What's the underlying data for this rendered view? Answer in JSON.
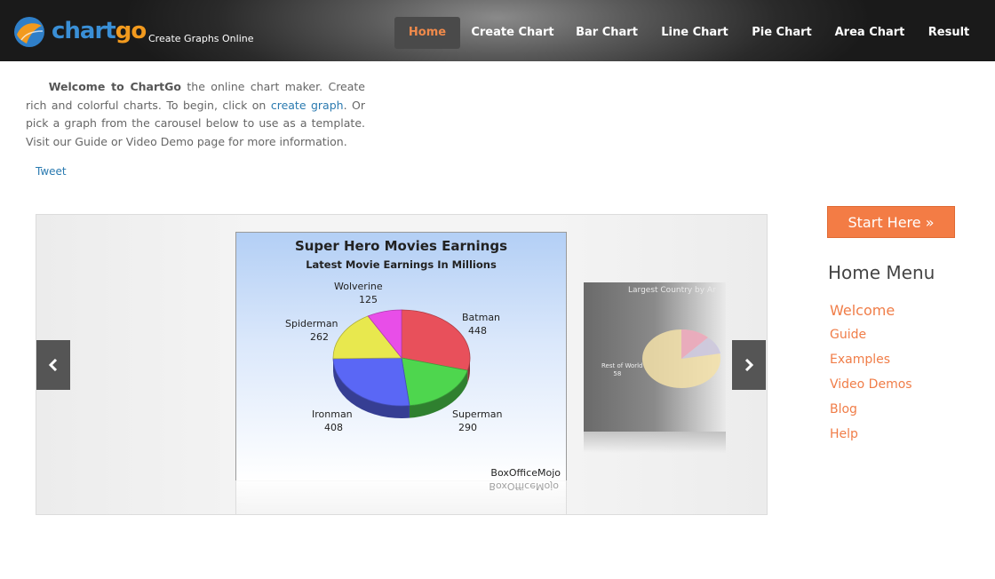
{
  "header": {
    "logo": {
      "part1": "chart",
      "part2": "go"
    },
    "tagline": "Create Graphs Online",
    "nav": [
      "Home",
      "Create Chart",
      "Bar Chart",
      "Line Chart",
      "Pie Chart",
      "Area Chart",
      "Result"
    ],
    "active_nav": "Home"
  },
  "intro": {
    "bold": "Welcome to ChartGo",
    "text1": " the online chart maker. Create rich and colorful charts. To begin, click on ",
    "link": "create graph",
    "text2": ". Or pick a graph from the carousel below to use as a template. Visit our Guide or Video Demo page for more information."
  },
  "tweet": "Tweet",
  "carousel": {
    "prev_icon": "chevron-left-icon",
    "next_icon": "chevron-right-icon",
    "side_title": "Largest Country by Ar",
    "side_label_1": "Rest of World",
    "side_label_2": "58"
  },
  "chart_data": {
    "type": "pie",
    "title": "Super Hero Movies Earnings",
    "subtitle": "Latest Movie Earnings In Millions",
    "categories": [
      "Batman",
      "Superman",
      "Ironman",
      "Spiderman",
      "Wolverine"
    ],
    "values": [
      448,
      290,
      408,
      262,
      125
    ],
    "colors": [
      "#e8505b",
      "#4ed64e",
      "#5a67f5",
      "#e8e84e",
      "#e84ee8"
    ],
    "source": "BoxOfficeMojo"
  },
  "sidebar": {
    "start_button": "Start Here »",
    "menu_title": "Home Menu",
    "items": [
      "Welcome",
      "Guide",
      "Examples",
      "Video Demos",
      "Blog",
      "Help"
    ]
  },
  "colors": {
    "accent": "#f37c45",
    "link": "#2a7ab0"
  }
}
